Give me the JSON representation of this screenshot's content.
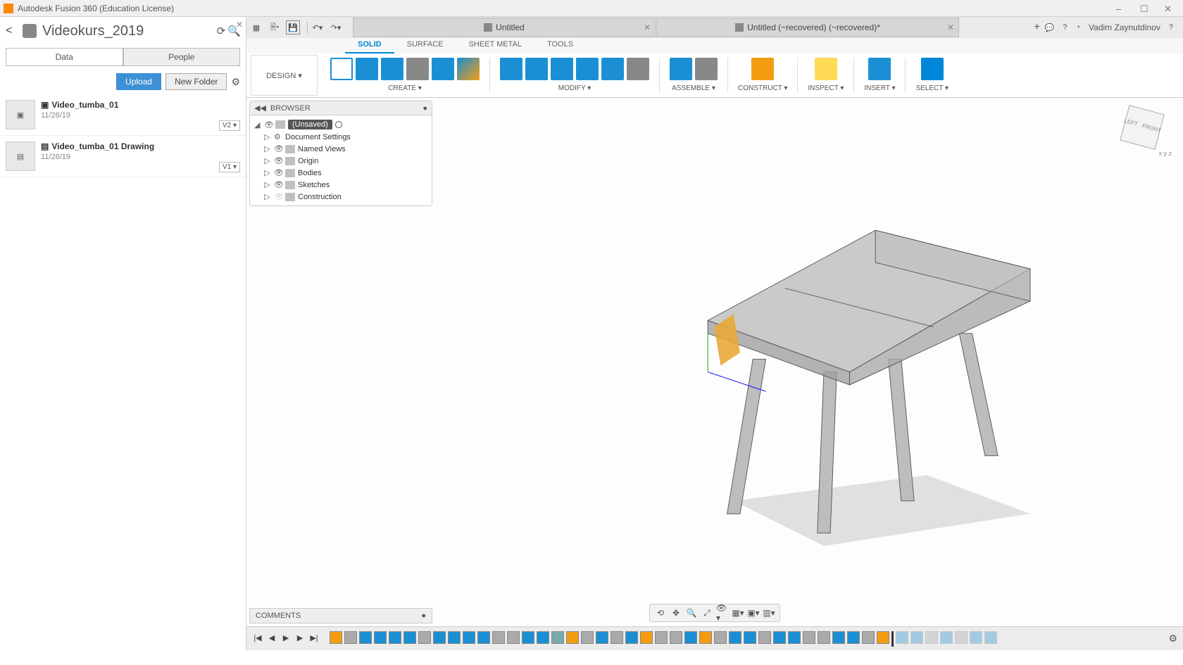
{
  "app": {
    "title": "Autodesk Fusion 360 (Education License)"
  },
  "window": {
    "minimize": "–",
    "maximize": "☐",
    "close": "✕"
  },
  "data_panel": {
    "title": "Videokurs_2019",
    "tabs": {
      "data": "Data",
      "people": "People"
    },
    "buttons": {
      "upload": "Upload",
      "new_folder": "New Folder"
    },
    "files": [
      {
        "name": "Video_tumba_01",
        "date": "11/26/19",
        "version": "V2 ▾",
        "type_icon": "▣"
      },
      {
        "name": "Video_tumba_01 Drawing",
        "date": "11/26/19",
        "version": "V1 ▾",
        "type_icon": "▤"
      }
    ]
  },
  "doc_tabs": [
    {
      "label": "Untitled"
    },
    {
      "label": "Untitled (~recovered) (~recovered)*"
    }
  ],
  "user": "Vadim Zaynutdinov",
  "ribbon": {
    "workspace": "DESIGN ▾",
    "tabs": [
      "SOLID",
      "SURFACE",
      "SHEET METAL",
      "TOOLS"
    ],
    "active_tab": "SOLID",
    "groups": {
      "create": "CREATE ▾",
      "modify": "MODIFY ▾",
      "assemble": "ASSEMBLE ▾",
      "construct": "CONSTRUCT ▾",
      "inspect": "INSPECT ▾",
      "insert": "INSERT ▾",
      "select": "SELECT ▾"
    }
  },
  "browser": {
    "title": "BROWSER",
    "root": "(Unsaved)",
    "nodes": [
      "Document Settings",
      "Named Views",
      "Origin",
      "Bodies",
      "Sketches",
      "Construction"
    ]
  },
  "comments": {
    "title": "COMMENTS"
  },
  "viewcube": {
    "left": "LEFT",
    "front": "FRONT"
  },
  "timeline": {
    "controls": {
      "first": "|◀",
      "prev": "◀",
      "play": "▶",
      "next": "▶",
      "last": "▶|"
    }
  }
}
